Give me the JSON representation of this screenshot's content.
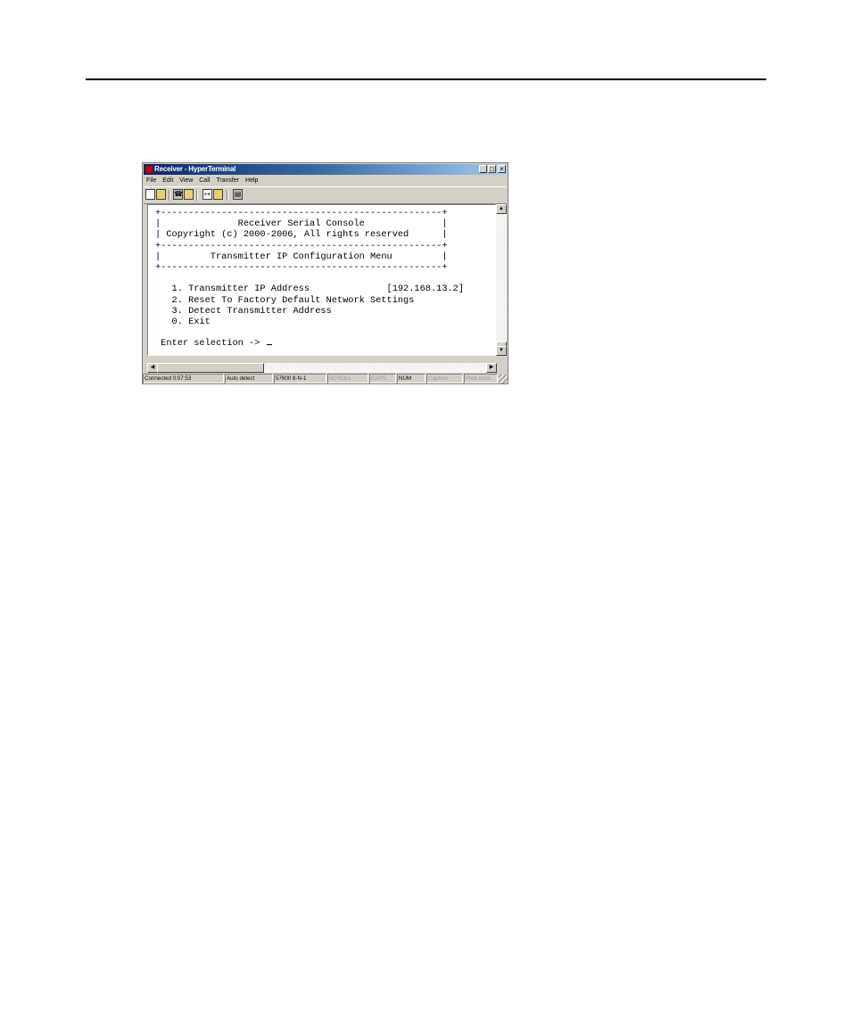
{
  "window": {
    "title": "Receiver - HyperTerminal",
    "controls": {
      "minimize": "_",
      "maximize": "□",
      "close": "×"
    }
  },
  "menu": [
    "File",
    "Edit",
    "View",
    "Call",
    "Transfer",
    "Help"
  ],
  "toolbar": {
    "icons": [
      "new-document-icon",
      "open-folder-icon",
      "dial-icon",
      "disconnect-icon",
      "send-icon",
      "receive-icon",
      "properties-icon"
    ]
  },
  "console": {
    "lines": [
      "+---------------------------------------------------+",
      "|              Receiver Serial Console              |",
      "| Copyright (c) 2000-2006, All rights reserved      |",
      "+---------------------------------------------------+",
      "|         Transmitter IP Configuration Menu         |",
      "+---------------------------------------------------+",
      "",
      "   1. Transmitter IP Address              [192.168.13.2]",
      "   2. Reset To Factory Default Network Settings",
      "   3. Detect Transmitter Address",
      "   0. Exit",
      "",
      " Enter selection -> "
    ]
  },
  "status": {
    "connected": "Connected 0:07:53",
    "detect": "Auto detect",
    "port": "57600 8-N-1",
    "scroll": "SCROLL",
    "caps": "CAPS",
    "num": "NUM",
    "capture": "Capture",
    "print": "Print echo"
  },
  "colors": {
    "titlebar_start": "#0a246a",
    "titlebar_end": "#a6caf0",
    "chrome": "#d4d0c8"
  }
}
